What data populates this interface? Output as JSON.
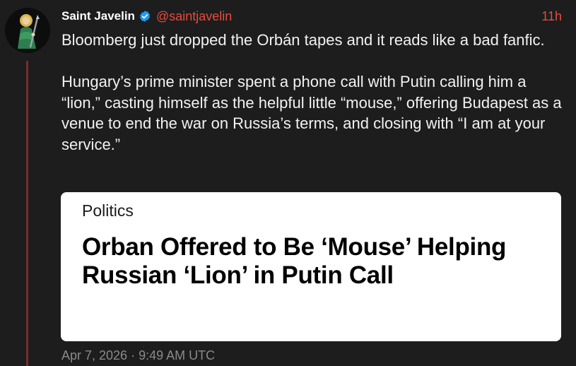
{
  "tweet": {
    "author_name": "Saint Javelin",
    "handle": "@saintjavelin",
    "time_ago": "11h",
    "text": "Bloomberg just dropped the Orbán tapes and it reads like a bad fanfic.\n\nHungary’s prime minister spent a phone call with Putin calling him a “lion,” casting himself as the helpful little “mouse,” offering Budapest as a venue to end the war on Russia’s terms, and closing with “I am at your service.”",
    "timestamp": "Apr 7, 2026 · 9:49 AM UTC"
  },
  "card": {
    "category": "Politics",
    "headline": "Orban Offered to Be ‘Mouse’ Helping Russian ‘Lion’ in Putin Call"
  },
  "icons": {
    "verified": "verified-badge-icon",
    "avatar": "saint-javelin-avatar"
  },
  "colors": {
    "background": "#1d1d1d",
    "accent": "#e84b3c",
    "verified": "#1d9bf0",
    "thread_line": "#7a2b2b",
    "muted": "#8a8a8a"
  }
}
